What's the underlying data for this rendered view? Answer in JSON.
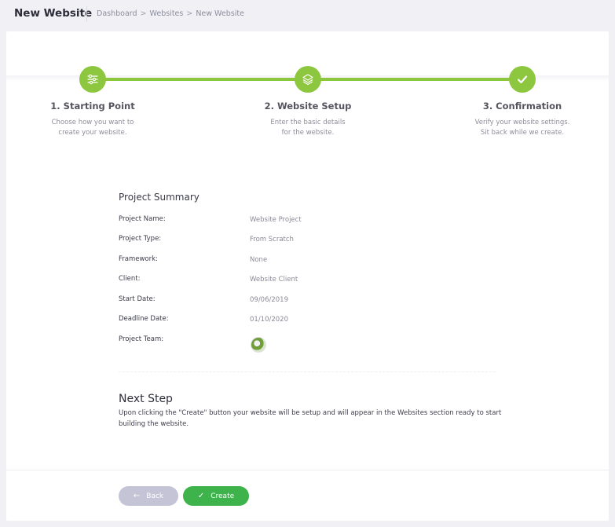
{
  "header": {
    "title": "New Website",
    "breadcrumb": [
      "Dashboard",
      "Websites",
      "New Website"
    ],
    "separator": ">"
  },
  "steps": [
    {
      "title": "1. Starting Point",
      "desc": [
        "Choose how you want to",
        "create your website."
      ],
      "icon": "sliders-icon"
    },
    {
      "title": "2. Website Setup",
      "desc": [
        "Enter the basic details",
        "for the website."
      ],
      "icon": "layers-icon"
    },
    {
      "title": "3. Confirmation",
      "desc": [
        "Verify your website settings.",
        "Sit back while we create."
      ],
      "icon": "check-icon"
    }
  ],
  "colors": {
    "accent": "#8dc63f",
    "create": "#3eb24b",
    "back": "#c4c4d6"
  },
  "summary": {
    "title": "Project Summary",
    "rows": [
      {
        "label": "Project Name:",
        "value": "Website Project"
      },
      {
        "label": "Project Type:",
        "value": "From Scratch"
      },
      {
        "label": "Framework:",
        "value": "None"
      },
      {
        "label": "Client:",
        "value": "Website Client"
      },
      {
        "label": "Start Date:",
        "value": "09/06/2019"
      },
      {
        "label": "Deadline Date:",
        "value": "01/10/2020"
      },
      {
        "label": "Project Team:",
        "value": ""
      }
    ]
  },
  "next": {
    "title": "Next Step",
    "text": "Upon clicking the \"Create\" button your website will be setup and will appear in the Websites section ready to start building the website."
  },
  "buttons": {
    "back": "Back",
    "create": "Create"
  }
}
